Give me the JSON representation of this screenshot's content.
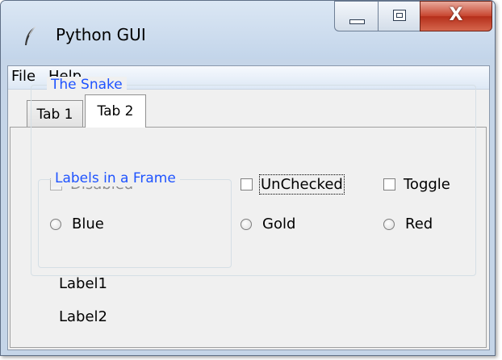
{
  "window": {
    "title": "Python GUI",
    "app_icon": "feather-icon"
  },
  "controls": {
    "minimize": "minimize-icon",
    "maximize": "maximize-icon",
    "close": "X"
  },
  "menu": {
    "file": "File",
    "help": "Help"
  },
  "tabs": [
    {
      "label": "Tab 1",
      "selected": false
    },
    {
      "label": "Tab 2",
      "selected": true
    }
  ],
  "snake_frame": {
    "title": "The Snake",
    "checkboxes": [
      {
        "label": "Disabled",
        "checked": true,
        "enabled": false
      },
      {
        "label": "UnChecked",
        "checked": false,
        "enabled": true,
        "focused": true
      },
      {
        "label": "Toggle",
        "checked": false,
        "enabled": true
      }
    ],
    "radios": [
      {
        "label": "Blue",
        "selected": false
      },
      {
        "label": "Gold",
        "selected": false
      },
      {
        "label": "Red",
        "selected": false
      }
    ]
  },
  "labels_frame": {
    "title": "Labels in a Frame",
    "labels": [
      "Label1",
      "Label2"
    ]
  },
  "colors": {
    "group_title": "#1e53ff",
    "disabled_text": "#8d8d8d",
    "close_button": "#c7452f"
  }
}
